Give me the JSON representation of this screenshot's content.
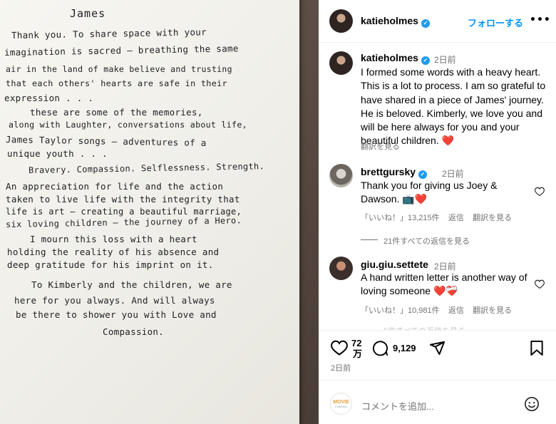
{
  "letter": {
    "lines": [
      "James",
      "Thank you. To share space with your",
      "imagination is sacred — breathing the same",
      "air in the land of make believe and trusting",
      "that each others' hearts are safe in their",
      "expression . . .",
      "these are some of the memories,",
      "along with Laughter, conversations about life,",
      "James Taylor songs — adventures of a",
      "unique youth . . .",
      "Bravery. Compassion. Selflessness. Strength.",
      "An appreciation for life and the action",
      "taken to live life with the integrity that",
      "life is art — creating a beautiful marriage,",
      "six loving children — the journey of a Hero.",
      "I mourn this loss with a heart",
      "holding the reality of his absence and",
      "deep gratitude for his imprint on it.",
      "To Kimberly and the children, we are",
      "here for you always. And will always",
      "be there to shower you with Love and",
      "Compassion."
    ]
  },
  "header": {
    "username": "katieholmes",
    "follow_label": "フォローする",
    "more_label": "•••"
  },
  "caption": {
    "username": "katieholmes",
    "time": "2日前",
    "text": "I formed some words with a heavy heart. This is a lot to process. I am so grateful to have shared in a piece of James' journey. He is beloved. Kimberly, we love you and will be here always for you and your beautiful children. ❤️",
    "translate": "翻訳を見る"
  },
  "comments": [
    {
      "username": "brettgursky",
      "time": "2日前",
      "text": "Thank you for giving us Joey & Dawson. 📺❤️",
      "likes": "「いいね！」13,215件",
      "reply": "返信",
      "translate": "翻訳を見る",
      "view_replies": "21件すべての返信を見る"
    },
    {
      "username": "giu.giu.settete",
      "time": "2日前",
      "text": "A hand written letter is another way of loving someone ❤️❤️‍🩹",
      "likes": "「いいね！」10,981件",
      "reply": "返信",
      "translate": "翻訳を見る",
      "view_replies": "5件すべての返信を見る"
    }
  ],
  "actions": {
    "likes_count_line1": "72",
    "likes_count_line2": "万",
    "comments_count": "9,129",
    "post_time": "2日前"
  },
  "add_comment": {
    "placeholder": "コメントを追加...",
    "avatar_text": "MOVIE",
    "avatar_sub": "Collection"
  },
  "colors": {
    "accent": "#0095f6",
    "verified": "#1d9bf0",
    "heart": "#ed4956",
    "muted": "#737373"
  },
  "icons": [
    "verified-icon",
    "heart-icon",
    "comment-icon",
    "share-icon",
    "bookmark-icon",
    "emoji-icon",
    "more-icon"
  ]
}
